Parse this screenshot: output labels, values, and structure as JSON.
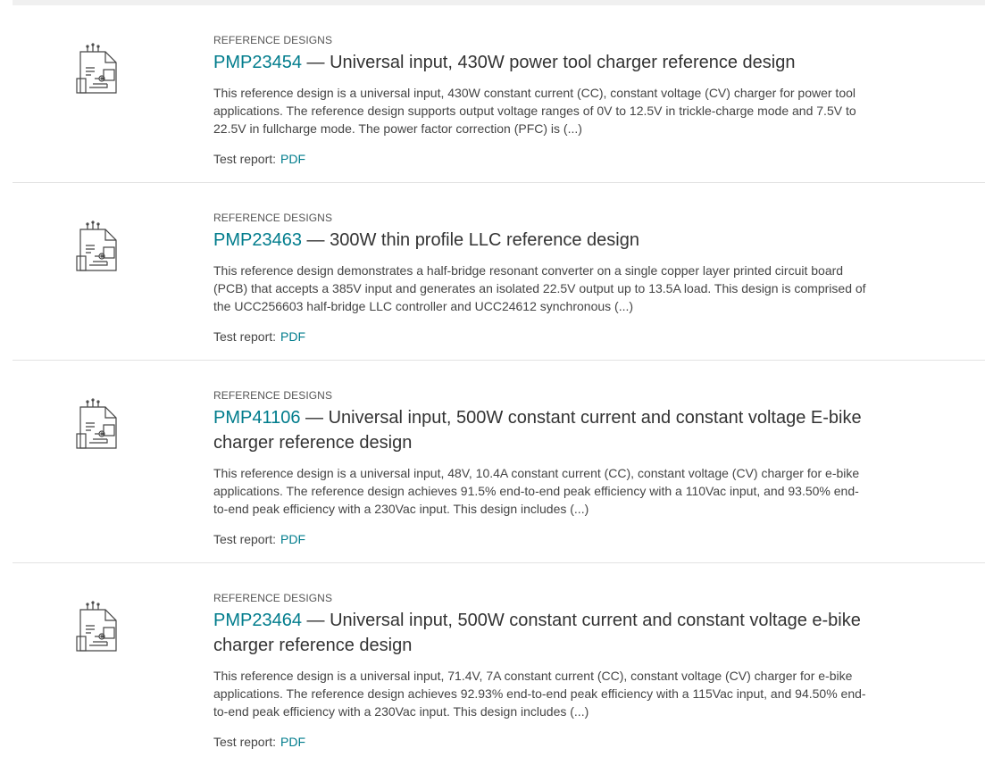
{
  "results": [
    {
      "icon": "reference-design-icon",
      "category": "REFERENCE DESIGNS",
      "part_number": "PMP23454",
      "title": " — Universal input, 430W power tool charger reference design",
      "description": "This reference design is a universal input, 430W constant current (CC), constant voltage (CV) charger for power tool applications. The reference design supports output voltage ranges of 0V to 12.5V in trickle-charge mode and 7.5V to 22.5V in fullcharge mode. The power factor correction (PFC) is (...)",
      "report_label": "Test report:",
      "report_link": "PDF"
    },
    {
      "icon": "reference-design-icon",
      "category": "REFERENCE DESIGNS",
      "part_number": "PMP23463",
      "title": " — 300W thin profile LLC reference design",
      "description": "This reference design demonstrates a half-bridge resonant converter on a single copper layer printed circuit board (PCB) that accepts a 385V input and generates an isolated 22.5V output up to 13.5A load. This design is comprised of the UCC256603 half-bridge LLC controller and UCC24612 synchronous (...)",
      "report_label": "Test report:",
      "report_link": "PDF"
    },
    {
      "icon": "reference-design-icon",
      "category": "REFERENCE DESIGNS",
      "part_number": "PMP41106",
      "title": " — Universal input, 500W constant current and constant voltage E-bike charger reference design",
      "description": "This reference design is a universal input, 48V, 10.4A constant current (CC), constant voltage (CV) charger for e-bike applications. The reference design achieves 91.5% end-to-end peak efficiency with a 110Vac input, and 93.50% end-to-end peak efficiency with a 230Vac input. This design includes (...)",
      "report_label": "Test report:",
      "report_link": "PDF"
    },
    {
      "icon": "reference-design-icon",
      "category": "REFERENCE DESIGNS",
      "part_number": "PMP23464",
      "title": " — Universal input, 500W constant current and constant voltage e-bike charger reference design",
      "description": "This reference design is a universal input, 71.4V, 7A constant current (CC), constant voltage (CV) charger for e-bike applications. The reference design achieves 92.93% end-to-end peak efficiency with a 115Vac input, and 94.50% end-to-end peak efficiency with a 230Vac input. This design includes (...)",
      "report_label": "Test report:",
      "report_link": "PDF"
    }
  ],
  "colors": {
    "link": "#007c8c",
    "text": "#333333",
    "divider": "#e3e3e3"
  }
}
